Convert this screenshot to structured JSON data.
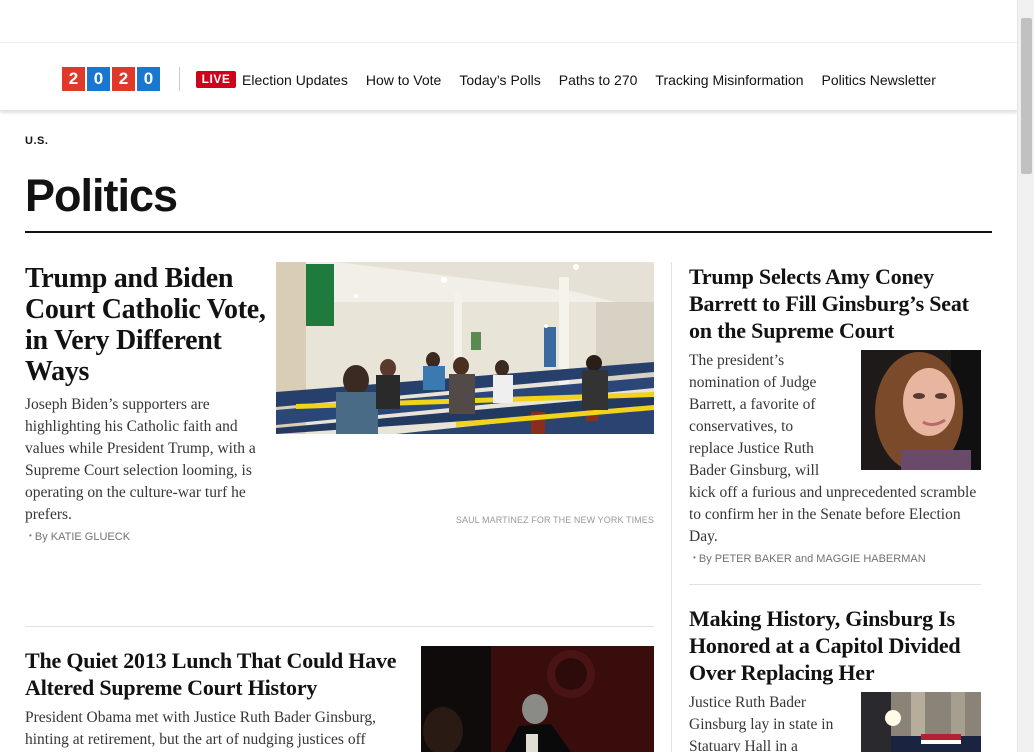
{
  "nav": {
    "logo_digits": [
      "2",
      "0",
      "2",
      "0"
    ],
    "live_label": "LIVE",
    "links": [
      "Election Updates",
      "How to Vote",
      "Today’s Polls",
      "Paths to 270",
      "Tracking Misinformation",
      "Politics Newsletter"
    ]
  },
  "section": {
    "kicker": "U.S.",
    "title": "Politics"
  },
  "lead": {
    "headline": "Trump and Biden Court Catholic Vote, in Very Different Ways",
    "summary": "Joseph Biden’s supporters are highlighting his Catholic faith and values while President Trump, with a Supreme Court selection looming, is operating on the culture-war turf he prefers.",
    "byline": "By KATIE GLUECK",
    "credit": "SAUL MARTINEZ FOR THE NEW YORK TIMES"
  },
  "story2": {
    "headline": "The Quiet 2013 Lunch That Could Have Altered Supreme Court History",
    "summary": "President Obama met with Justice Ruth Bader Ginsburg, hinting at retirement, but the art of nudging justices off"
  },
  "side1": {
    "headline": "Trump Selects Amy Coney Barrett to Fill Ginsburg’s Seat on the Supreme Court",
    "summary_wrapped": [
      "The president’s",
      "nomination of Judge",
      "Barrett, a favorite of",
      "conservatives, to",
      "replace Justice Ruth",
      "Bader Ginsburg, will"
    ],
    "summary_rest": "kick off a furious and unprecedented scramble to confirm her in the Senate before Election Day.",
    "byline": "By PETER BAKER and MAGGIE HABERMAN"
  },
  "side2": {
    "headline": "Making History, Ginsburg Is Honored at a Capitol Divided Over Replacing Her",
    "summary": "Justice Ruth Bader Ginsburg lay in state in Statuary Hall in a"
  },
  "colors": {
    "logo_red": "#e1382c",
    "logo_blue": "#1a77d0",
    "live_red": "#d0021b"
  }
}
